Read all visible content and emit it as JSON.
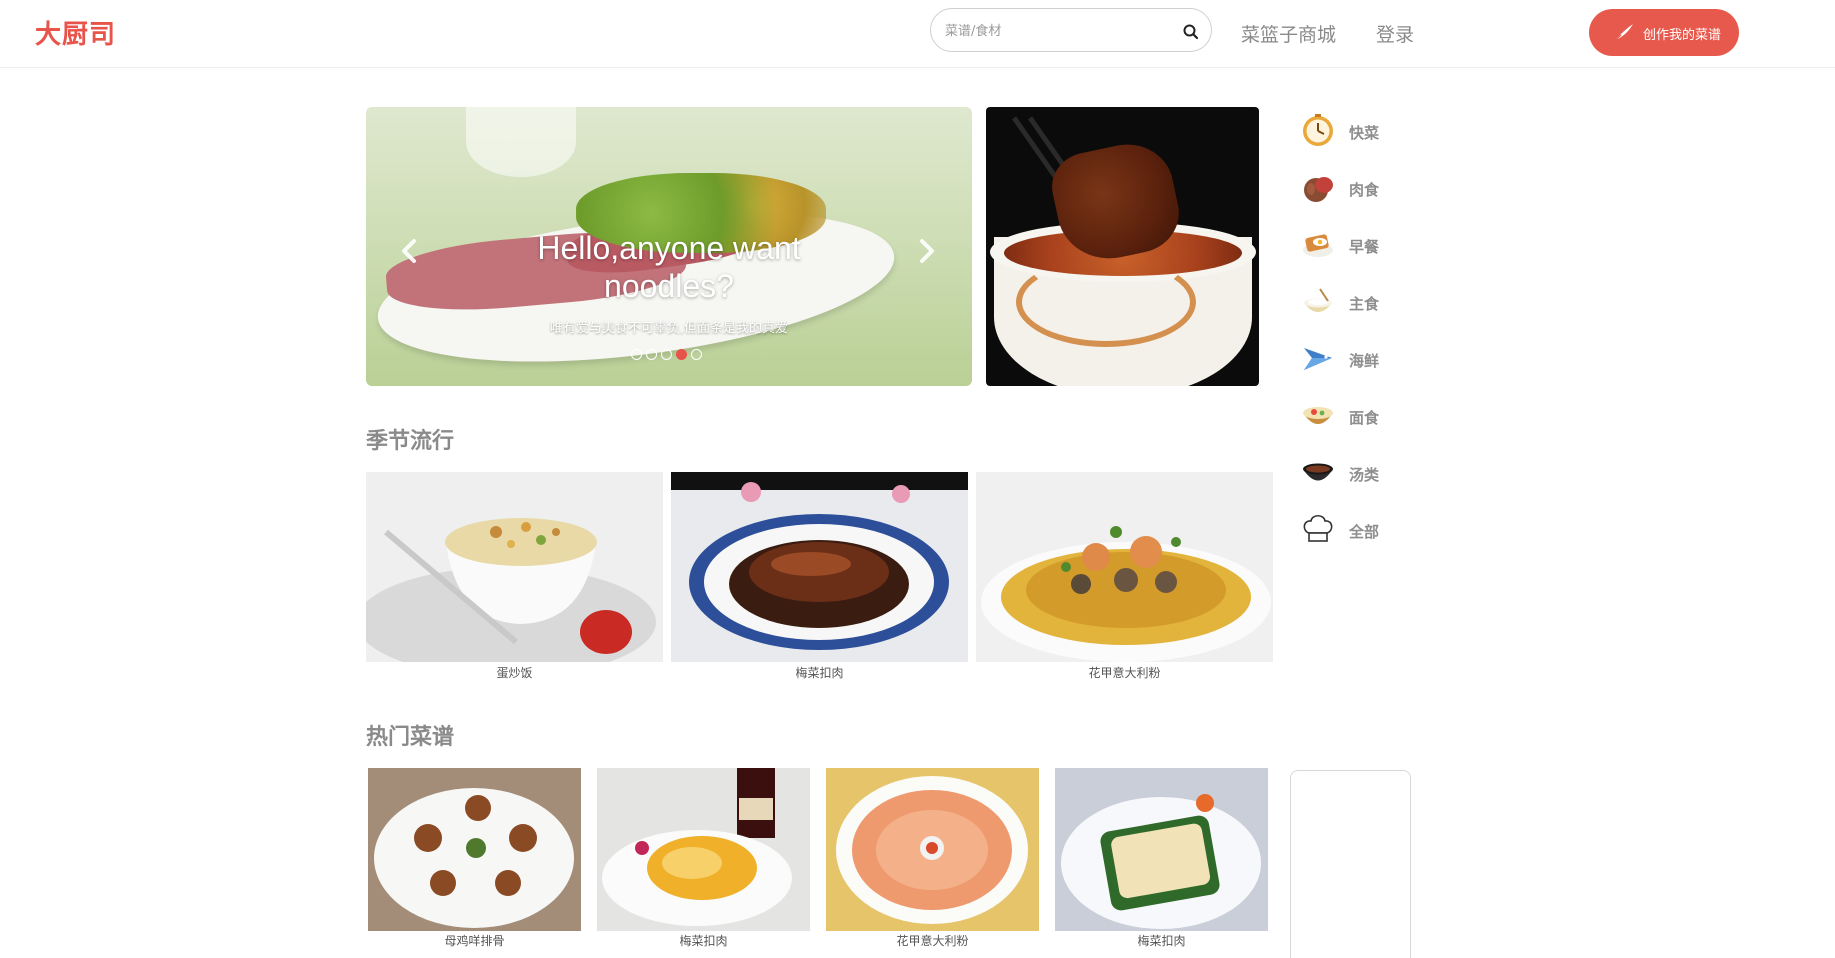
{
  "header": {
    "logo": "大厨司",
    "search": {
      "placeholder": "菜谱/食材"
    },
    "nav": {
      "mall": "菜篮子商城",
      "login": "登录"
    },
    "create_button": "创作我的菜谱",
    "accent_color": "#e8594d"
  },
  "carousel": {
    "title_line1": "Hello,anyone want",
    "title_line2": "noodles?",
    "subtitle": "唯有爱与美食不可辜负,但面条是我的真爱",
    "slide_count": 5,
    "active_index": 3
  },
  "categories": [
    {
      "label": "快菜",
      "icon": "clock-icon"
    },
    {
      "label": "肉食",
      "icon": "meat-icon"
    },
    {
      "label": "早餐",
      "icon": "breakfast-icon"
    },
    {
      "label": "主食",
      "icon": "rice-bowl-icon"
    },
    {
      "label": "海鲜",
      "icon": "fish-icon"
    },
    {
      "label": "面食",
      "icon": "noodle-bowl-icon"
    },
    {
      "label": "汤类",
      "icon": "soup-pot-icon"
    },
    {
      "label": "全部",
      "icon": "chef-hat-icon"
    }
  ],
  "sections": {
    "seasonal": {
      "title": "季节流行",
      "items": [
        {
          "name": "蛋炒饭"
        },
        {
          "name": "梅菜扣肉"
        },
        {
          "name": "花甲意大利粉"
        }
      ]
    },
    "hot": {
      "title": "热门菜谱",
      "items": [
        {
          "name": "母鸡咩排骨"
        },
        {
          "name": "梅菜扣肉"
        },
        {
          "name": "花甲意大利粉"
        },
        {
          "name": "梅菜扣肉"
        }
      ]
    }
  }
}
